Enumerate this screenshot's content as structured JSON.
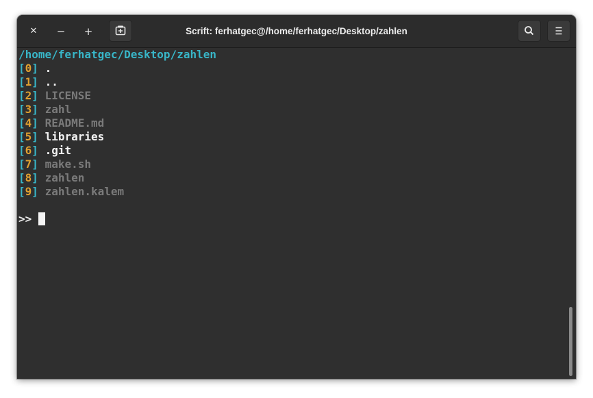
{
  "window": {
    "title": "Scrift: ferhatgec@/home/ferhatgec/Desktop/zahlen",
    "controls": {
      "close_label": "✕",
      "minimize_label": "−",
      "maximize_label": "+"
    },
    "icons": {
      "new_tab": "new-tab-icon",
      "search": "search-icon",
      "menu": "hamburger-menu-icon"
    }
  },
  "terminal": {
    "cwd": "/home/ferhatgec/Desktop/zahlen",
    "entries": [
      {
        "open": "[",
        "index": "0",
        "close": "]",
        "name": ".",
        "style": "bright"
      },
      {
        "open": "[",
        "index": "1",
        "close": "]",
        "name": "..",
        "style": "bright"
      },
      {
        "open": "[",
        "index": "2",
        "close": "]",
        "name": "LICENSE",
        "style": "dim"
      },
      {
        "open": "[",
        "index": "3",
        "close": "]",
        "name": "zahl",
        "style": "dim"
      },
      {
        "open": "[",
        "index": "4",
        "close": "]",
        "name": "README.md",
        "style": "dim"
      },
      {
        "open": "[",
        "index": "5",
        "close": "]",
        "name": "libraries",
        "style": "bright"
      },
      {
        "open": "[",
        "index": "6",
        "close": "]",
        "name": ".git",
        "style": "bright"
      },
      {
        "open": "[",
        "index": "7",
        "close": "]",
        "name": "make.sh",
        "style": "dim"
      },
      {
        "open": "[",
        "index": "8",
        "close": "]",
        "name": "zahlen",
        "style": "dim"
      },
      {
        "open": "[",
        "index": "9",
        "close": "]",
        "name": "zahlen.kalem",
        "style": "dim"
      }
    ],
    "prompt": ">>"
  },
  "colors": {
    "background": "#2f2f2f",
    "path": "#38b6c8",
    "index": "#e0a030",
    "file": "#7a7a7a",
    "directory": "#f2f2f2"
  }
}
